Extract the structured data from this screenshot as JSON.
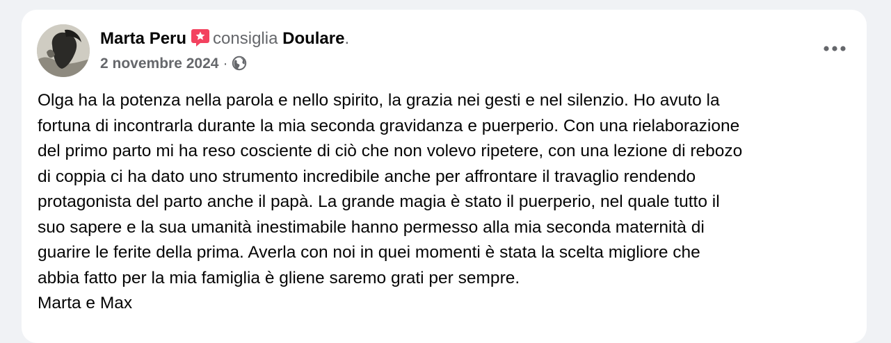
{
  "post": {
    "author": "Marta Peru",
    "verb": "consiglia",
    "page_name": "Doulare",
    "punctuation": ".",
    "date": "2 novembre 2024",
    "separator": "·",
    "privacy_icon": "globe-icon",
    "recommend_icon": "recommend-badge-icon",
    "more_icon": "more-horizontal-icon",
    "body": "Olga ha la potenza nella parola e nello spirito, la grazia nei gesti e nel silenzio. Ho avuto la\nfortuna di incontrarla durante la mia seconda gravidanza e puerperio. Con una rielaborazione\ndel primo parto mi ha reso cosciente di ciò che non volevo ripetere, con una lezione di rebozo\ndi coppia ci ha dato uno strumento incredibile anche per affrontare il travaglio rendendo\nprotagonista del parto anche il papà. La grande magia è stato il puerperio, nel quale tutto il\nsuo sapere e la sua umanità inestimabile hanno permesso alla mia seconda maternità di\nguarire le ferite della prima. Averla con noi in quei momenti è stata la scelta migliore che\nabbia fatto per la mia famiglia è gliene saremo grati per sempre.\nMarta e Max"
  },
  "colors": {
    "background": "#f0f2f5",
    "card": "#ffffff",
    "primary_text": "#050505",
    "secondary_text": "#65676b",
    "recommend_badge": "#f3425f"
  }
}
